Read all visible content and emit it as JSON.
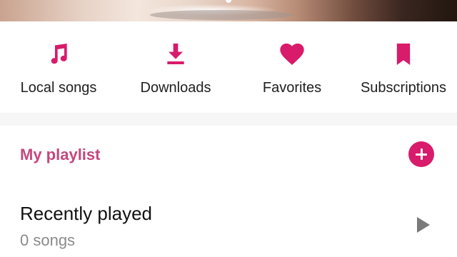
{
  "colors": {
    "accent": "#d81b6a",
    "section_title": "#c4487d"
  },
  "quick_access": [
    {
      "icon": "music-note-icon",
      "label": "Local songs"
    },
    {
      "icon": "download-icon",
      "label": "Downloads"
    },
    {
      "icon": "heart-icon",
      "label": "Favorites"
    },
    {
      "icon": "bookmark-icon",
      "label": "Subscriptions"
    }
  ],
  "playlist": {
    "title": "My playlist",
    "add_icon": "add-circle-icon",
    "items": [
      {
        "title": "Recently played",
        "subtitle": "0 songs",
        "icon": "play-arrow-icon"
      }
    ]
  }
}
